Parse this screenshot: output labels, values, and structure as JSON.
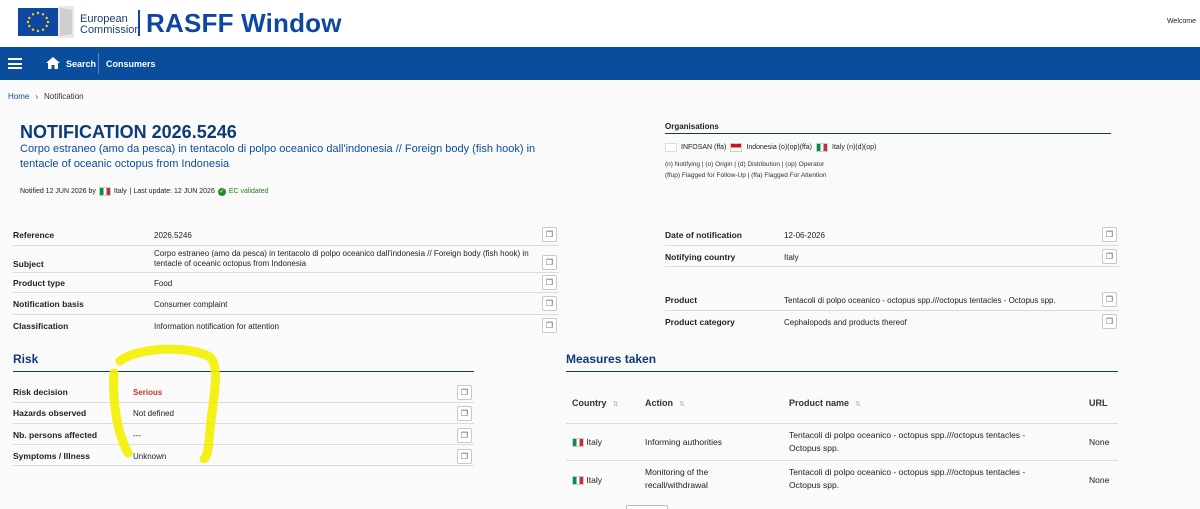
{
  "header": {
    "ec_line1": "European",
    "ec_line2": "Commission",
    "app_title": "RASFF Window",
    "welcome": "Welcome"
  },
  "nav": {
    "search": "Search",
    "consumers": "Consumers"
  },
  "breadcrumb": {
    "home": "Home",
    "current": "Notification"
  },
  "notification": {
    "title": "NOTIFICATION 2026.5246",
    "subject": "Corpo estraneo (amo da pesca) in tentacolo di polpo oceanico dall'indonesia // Foreign body (fish hook) in tentacle of oceanic octopus from Indonesia",
    "notified_prefix": "Notified 12 JUN 2026 by",
    "notified_country": "Italy",
    "last_update": "| Last update: 12 JUN 2026",
    "validated": "EC validated"
  },
  "organisations": {
    "title": "Organisations",
    "infosan": "INFOSAN (ffa)",
    "indonesia": "Indonesia (o)(op)(ffa)",
    "italy": "Italy (n)(d)(op)",
    "legend_line1": "(n) Notifying | (o) Origin | (d) Distribution | (op) Operator",
    "legend_line2": "(ffup) Flagged for Follow-Up | (ffa) Flagged For Attention"
  },
  "details_left": [
    {
      "label": "Reference",
      "value": "2026.5246"
    },
    {
      "label": "Subject",
      "value": "Corpo estraneo (amo da pesca) in tentacolo di polpo oceanico dall'indonesia // Foreign body (fish hook) in tentacle of oceanic octopus from Indonesia"
    },
    {
      "label": "Product type",
      "value": "Food"
    },
    {
      "label": "Notification basis",
      "value": "Consumer complaint"
    },
    {
      "label": "Classification",
      "value": "Information notification for attention"
    }
  ],
  "details_right": [
    {
      "label": "Date of notification",
      "value": "12-06-2026"
    },
    {
      "label": "Notifying country",
      "value": "Italy"
    },
    {
      "label": "Product",
      "value": "Tentacoli di polpo oceanico - octopus spp.///octopus tentacles - Octopus spp."
    },
    {
      "label": "Product category",
      "value": "Cephalopods and products thereof"
    }
  ],
  "risk": {
    "title": "Risk",
    "rows": [
      {
        "label": "Risk decision",
        "value": "Serious"
      },
      {
        "label": "Hazards observed",
        "value": "Not defined"
      },
      {
        "label": "Nb. persons affected",
        "value": "---"
      },
      {
        "label": "Symptoms / Illness",
        "value": "Unknown"
      }
    ]
  },
  "measures": {
    "title": "Measures taken",
    "columns": [
      "Country",
      "Action",
      "Product name",
      "URL"
    ],
    "rows": [
      {
        "country": "Italy",
        "action": "Informing authorities",
        "product": "Tentacoli di polpo oceanico - octopus spp.///octopus tentacles - Octopus spp.",
        "url": "None"
      },
      {
        "country": "Italy",
        "action": "Monitoring of the recall/withdrawal",
        "product": "Tentacoli di polpo oceanico - octopus spp.///octopus tentacles - Octopus spp.",
        "url": "None"
      }
    ]
  },
  "colors": {
    "nav_blue": "#0a4d9d",
    "title_blue": "#0e3a78",
    "serious_red": "#c0392b",
    "highlight_yellow": "#f3f000"
  },
  "icons": [
    "ec-flag-logo",
    "hamburger-icon",
    "home-icon",
    "copy-icon",
    "sort-icon",
    "check-icon"
  ]
}
